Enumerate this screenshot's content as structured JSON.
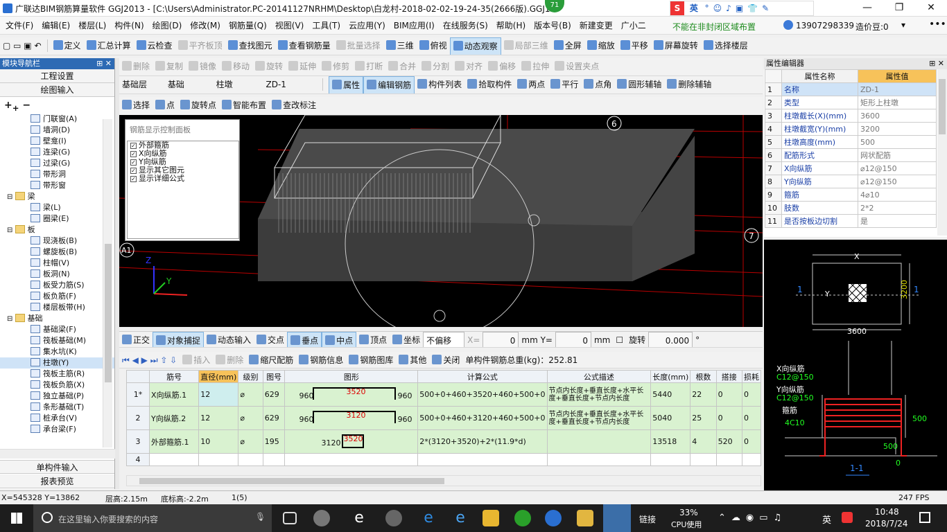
{
  "title_bar": {
    "text": "广联达BIM钢筋算量软件 GGJ2013 - [C:\\Users\\Administrator.PC-20141127NRHM\\Desktop\\白龙村-2018-02-02-19-24-35(2666版).GGJ12",
    "badge": "71",
    "ime": "英",
    "min": "—",
    "max": "❐",
    "close": "✕"
  },
  "menu": [
    "文件(F)",
    "编辑(E)",
    "楼层(L)",
    "构件(N)",
    "绘图(D)",
    "修改(M)",
    "钢筋量(Q)",
    "视图(V)",
    "工具(T)",
    "云应用(Y)",
    "BIM应用(I)",
    "在线服务(S)",
    "帮助(H)",
    "版本号(B)",
    "新建变更",
    "广小二"
  ],
  "menu_right": {
    "notice": "不能在非封闭区域布置",
    "phone": "13907298339",
    "coin": "造价豆:0"
  },
  "toolbar1": [
    "定义",
    "汇总计算",
    "云检查",
    "平齐板顶",
    "查找图元",
    "查看钢筋量",
    "批量选择",
    "三维",
    "俯视",
    "动态观察",
    "局部三维",
    "全屏",
    "缩放",
    "平移",
    "屏幕旋转",
    "选择楼层"
  ],
  "toolbar2": [
    "删除",
    "复制",
    "镜像",
    "移动",
    "旋转",
    "延伸",
    "修剪",
    "打断",
    "合并",
    "分割",
    "对齐",
    "偏移",
    "拉伸",
    "设置夹点"
  ],
  "toolbar3": {
    "layer": "基础层",
    "type": "基础",
    "comp": "柱墩",
    "name": "ZD-1",
    "items": [
      "属性",
      "编辑钢筋",
      "构件列表",
      "拾取构件",
      "两点",
      "平行",
      "点角",
      "圆形辅轴",
      "删除辅轴"
    ]
  },
  "toolbar4": [
    "选择",
    "点",
    "旋转点",
    "智能布置",
    "查改标注"
  ],
  "left_panel": {
    "title": "模块导航栏",
    "buttons": [
      "工程设置",
      "绘图输入"
    ],
    "bottom_buttons": [
      "单构件输入",
      "报表预览"
    ],
    "tree": [
      {
        "t": "门联窗(A)",
        "lvl": 2
      },
      {
        "t": "墙洞(D)",
        "lvl": 2
      },
      {
        "t": "壁龛(I)",
        "lvl": 2
      },
      {
        "t": "连梁(G)",
        "lvl": 2
      },
      {
        "t": "过梁(G)",
        "lvl": 2
      },
      {
        "t": "带形洞",
        "lvl": 2
      },
      {
        "t": "带形窗",
        "lvl": 2
      },
      {
        "t": "梁",
        "lvl": 1
      },
      {
        "t": "梁(L)",
        "lvl": 2
      },
      {
        "t": "圈梁(E)",
        "lvl": 2
      },
      {
        "t": "板",
        "lvl": 1
      },
      {
        "t": "现浇板(B)",
        "lvl": 2
      },
      {
        "t": "螺旋板(B)",
        "lvl": 2
      },
      {
        "t": "柱帽(V)",
        "lvl": 2
      },
      {
        "t": "板洞(N)",
        "lvl": 2
      },
      {
        "t": "板受力筋(S)",
        "lvl": 2
      },
      {
        "t": "板负筋(F)",
        "lvl": 2
      },
      {
        "t": "楼层板带(H)",
        "lvl": 2
      },
      {
        "t": "基础",
        "lvl": 1
      },
      {
        "t": "基础梁(F)",
        "lvl": 2
      },
      {
        "t": "筏板基础(M)",
        "lvl": 2
      },
      {
        "t": "集水坑(K)",
        "lvl": 2
      },
      {
        "t": "柱墩(Y)",
        "lvl": 2,
        "sel": true
      },
      {
        "t": "筏板主筋(R)",
        "lvl": 2
      },
      {
        "t": "筏板负筋(X)",
        "lvl": 2
      },
      {
        "t": "独立基础(P)",
        "lvl": 2
      },
      {
        "t": "条形基础(T)",
        "lvl": 2
      },
      {
        "t": "桩承台(V)",
        "lvl": 2
      },
      {
        "t": "承台梁(F)",
        "lvl": 2
      }
    ]
  },
  "rebar_panel": {
    "title": "钢筋显示控制面板",
    "items": [
      "外部箍筋",
      "X向纵筋",
      "Y向纵筋",
      "显示其它图元",
      "显示详细公式"
    ]
  },
  "viewport_labels": {
    "axis_6": "6",
    "axis_7": "7",
    "axis_A1": "A1",
    "z": "Z",
    "y": "Y",
    "x": "X"
  },
  "snap_bar": {
    "items": [
      "正交",
      "对象捕捉",
      "动态输入",
      "交点",
      "垂点",
      "中点",
      "顶点",
      "坐标"
    ],
    "offset": "不偏移",
    "x_label": "X=",
    "x_val": "0",
    "y_label": "mm Y=",
    "y_val": "0",
    "mm": "mm",
    "rotate": "旋转",
    "rot_val": "0.000",
    "deg": "°"
  },
  "rebar_toolbar": {
    "items": [
      "插入",
      "删除",
      "缩尺配筋",
      "钢筋信息",
      "钢筋图库",
      "其他",
      "关闭"
    ],
    "total": "单构件钢筋总重(kg)：252.81"
  },
  "rebar_table": {
    "headers": [
      "",
      "筋号",
      "直径(mm)",
      "级别",
      "图号",
      "图形",
      "计算公式",
      "公式描述",
      "长度(mm)",
      "根数",
      "搭接",
      "损耗"
    ],
    "rows": [
      {
        "no": "1*",
        "name": "X向纵筋.1",
        "dia": "12",
        "grade": "⌀",
        "fig": "629",
        "shape_l": "960",
        "shape_m": "3520",
        "shape_r": "960",
        "formula": "500+0+460+3520+460+500+0",
        "desc": "节点内长度+垂直长度+水平长度+垂直长度+节点内长度",
        "len": "5440",
        "count": "22",
        "lap": "0",
        "loss": "0"
      },
      {
        "no": "2",
        "name": "Y向纵筋.2",
        "dia": "12",
        "grade": "⌀",
        "fig": "629",
        "shape_l": "960",
        "shape_m": "3120",
        "shape_r": "960",
        "formula": "500+0+460+3120+460+500+0",
        "desc": "节点内长度+垂直长度+水平长度+垂直长度+节点内长度",
        "len": "5040",
        "count": "25",
        "lap": "0",
        "loss": "0"
      },
      {
        "no": "3",
        "name": "外部箍筋.1",
        "dia": "10",
        "grade": "⌀",
        "fig": "195",
        "shape_l": "3120",
        "shape_m": "3520",
        "shape_r": "",
        "formula": "2*(3120+3520)+2*(11.9*d)",
        "desc": "",
        "len": "13518",
        "count": "4",
        "lap": "520",
        "loss": "0"
      },
      {
        "no": "4",
        "name": "",
        "dia": "",
        "grade": "",
        "fig": "",
        "shape_l": "",
        "shape_m": "",
        "shape_r": "",
        "formula": "",
        "desc": "",
        "len": "",
        "count": "",
        "lap": "",
        "loss": ""
      }
    ]
  },
  "prop_panel": {
    "title": "属性编辑器",
    "col_name": "属性名称",
    "col_val": "属性值",
    "rows": [
      [
        "1",
        "名称",
        "ZD-1"
      ],
      [
        "2",
        "类型",
        "矩形上柱墩"
      ],
      [
        "3",
        "柱墩截长(X)(mm)",
        "3600"
      ],
      [
        "4",
        "柱墩截宽(Y)(mm)",
        "3200"
      ],
      [
        "5",
        "柱墩高度(mm)",
        "500"
      ],
      [
        "6",
        "配筋形式",
        "网状配筋"
      ],
      [
        "7",
        "X向纵筋",
        "⌀12@150"
      ],
      [
        "8",
        "Y向纵筋",
        "⌀12@150"
      ],
      [
        "9",
        "箍筋",
        "4⌀10"
      ],
      [
        "10",
        "肢数",
        "2*2"
      ],
      [
        "11",
        "是否按板边切割",
        "是"
      ]
    ]
  },
  "diagram": {
    "x": "X",
    "y": "Y",
    "w": "3600",
    "h": "3200",
    "sec": "1",
    "xbar": "X向纵筋",
    "xbar_v": "C12@150",
    "ybar": "Y向纵筋",
    "ybar_v": "C12@150",
    "stir": "箍筋",
    "stir_v": "4C10",
    "d500": "500",
    "d500b": "500",
    "zero": "0",
    "cut": "1-1"
  },
  "status": {
    "coords": "X=545328 Y=13862",
    "floor_h": "层高:2.15m",
    "base_h": "底标高:-2.2m",
    "count": "1(5)",
    "fps": "247 FPS"
  },
  "taskbar": {
    "search": "在这里输入你要搜索的内容",
    "link": "链接",
    "cpu": "33%",
    "cpu_label": "CPU使用",
    "lang": "英",
    "time": "10:48",
    "date": "2018/7/24"
  }
}
